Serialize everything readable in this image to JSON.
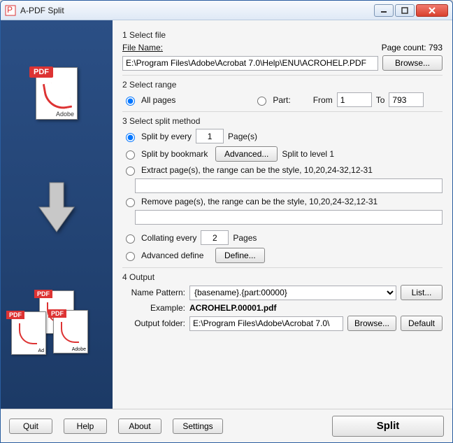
{
  "window": {
    "title": "A-PDF Split"
  },
  "section1": {
    "heading": "1 Select file",
    "fileNameLabel": "File Name:",
    "fileName": "E:\\Program Files\\Adobe\\Acrobat 7.0\\Help\\ENU\\ACROHELP.PDF",
    "pageCountLabel": "Page count:",
    "pageCount": "793",
    "browse": "Browse..."
  },
  "section2": {
    "heading": "2 Select range",
    "allPages": "All pages",
    "part": "Part:",
    "fromLabel": "From",
    "from": "1",
    "toLabel": "To",
    "to": "793"
  },
  "section3": {
    "heading": "3 Select split method",
    "splitByEvery": "Split by every",
    "splitByEveryN": "1",
    "pagesSuffix": "Page(s)",
    "splitByBookmark": "Split by bookmark",
    "advanced": "Advanced...",
    "splitToLevel": "Split to level 1",
    "extract": "Extract page(s), the range can be the style, 10,20,24-32,12-31",
    "extractValue": "",
    "remove": "Remove page(s), the range can be the style, 10,20,24-32,12-31",
    "removeValue": "",
    "collating": "Collating every",
    "collatingN": "2",
    "collatingSuffix": "Pages",
    "advancedDefine": "Advanced define",
    "define": "Define..."
  },
  "section4": {
    "heading": "4 Output",
    "namePatternLabel": "Name Pattern:",
    "namePattern": "{basename}.{part:00000}",
    "list": "List...",
    "exampleLabel": "Example:",
    "example": "ACROHELP.00001.pdf",
    "outputFolderLabel": "Output folder:",
    "outputFolder": "E:\\Program Files\\Adobe\\Acrobat 7.0\\",
    "browse": "Browse...",
    "default": "Default"
  },
  "bottom": {
    "quit": "Quit",
    "help": "Help",
    "about": "About",
    "settings": "Settings",
    "split": "Split"
  }
}
